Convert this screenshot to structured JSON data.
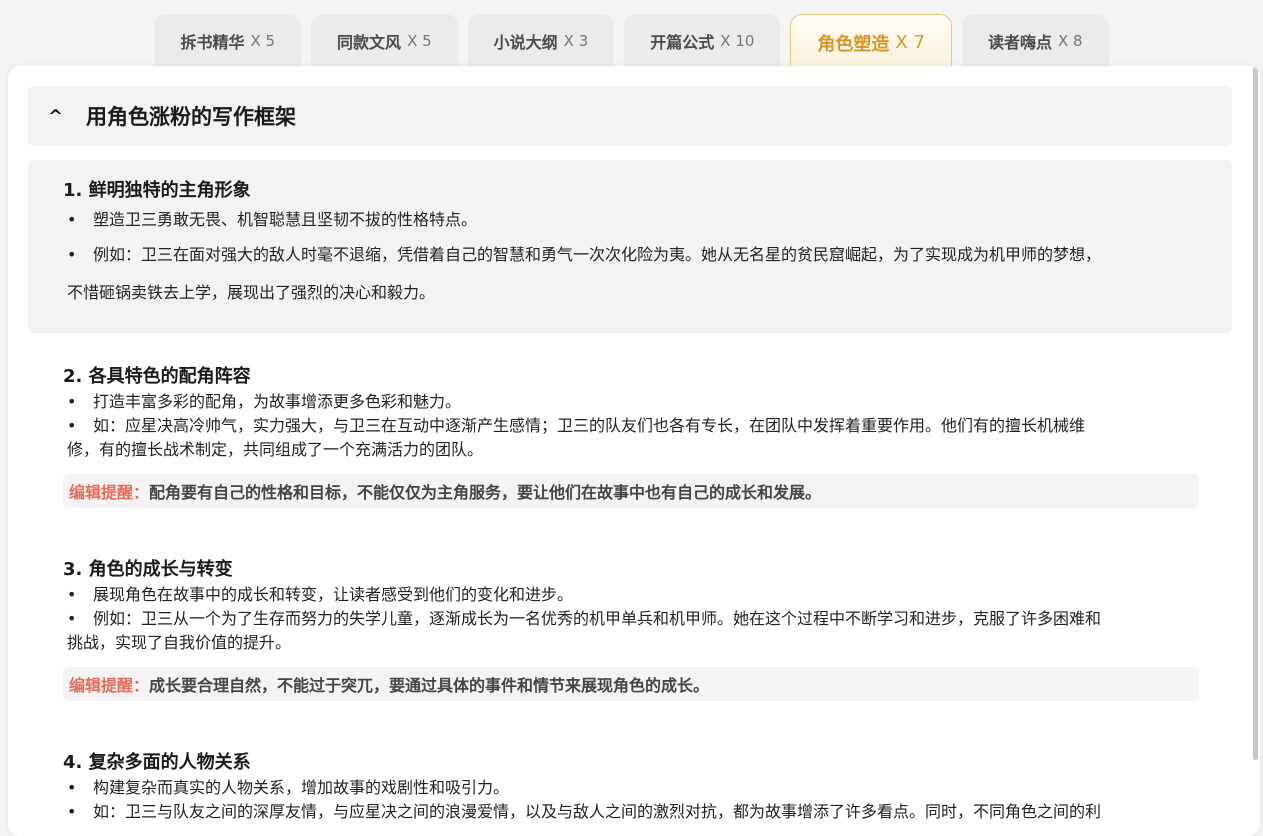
{
  "tabs": [
    {
      "name": "拆书精华",
      "count": "X 5"
    },
    {
      "name": "同款文风",
      "count": "X 5"
    },
    {
      "name": "小说大纲",
      "count": "X 3"
    },
    {
      "name": "开篇公式",
      "count": "X 10"
    },
    {
      "name": "角色塑造",
      "count": "X 7"
    },
    {
      "name": "读者嗨点",
      "count": "X 8"
    }
  ],
  "colors": {
    "accent": "#d8962a",
    "tip_label": "#e56d5c"
  },
  "header": {
    "caret": "^",
    "title": "用角色涨粉的写作框架"
  },
  "sections": [
    {
      "title": "1. 鲜明独特的主角形象",
      "bullets": [
        "塑造卫三勇敢无畏、机智聪慧且坚韧不拔的性格特点。",
        "例如：卫三在面对强大的敌人时毫不退缩，凭借着自己的智慧和勇气一次次化险为夷。她从无名星的贫民窟崛起，为了实现成为机甲师的梦想，"
      ],
      "continuation": "不惜砸锅卖铁去上学，展现出了强烈的决心和毅力。"
    },
    {
      "title": "2. 各具特色的配角阵容",
      "bullets": [
        "打造丰富多彩的配角，为故事增添更多色彩和魅力。",
        "如：应星决高冷帅气，实力强大，与卫三在互动中逐渐产生感情；卫三的队友们也各有专长，在团队中发挥着重要作用。他们有的擅长机械维"
      ],
      "continuation": "修，有的擅长战术制定，共同组成了一个充满活力的团队。",
      "tip_label": "编辑提醒：",
      "tip": "配角要有自己的性格和目标，不能仅仅为主角服务，要让他们在故事中也有自己的成长和发展。"
    },
    {
      "title": "3. 角色的成长与转变",
      "bullets": [
        "展现角色在故事中的成长和转变，让读者感受到他们的变化和进步。",
        "例如：卫三从一个为了生存而努力的失学儿童，逐渐成长为一名优秀的机甲单兵和机甲师。她在这个过程中不断学习和进步，克服了许多困难和"
      ],
      "continuation": "挑战，实现了自我价值的提升。",
      "tip_label": "编辑提醒：",
      "tip": "成长要合理自然，不能过于突兀，要通过具体的事件和情节来展现角色的成长。"
    },
    {
      "title": "4. 复杂多面的人物关系",
      "bullets": [
        "构建复杂而真实的人物关系，增加故事的戏剧性和吸引力。",
        "如：卫三与队友之间的深厚友情，与应星决之间的浪漫爱情，以及与敌人之间的激烈对抗，都为故事增添了许多看点。同时，不同角色之间的利"
      ]
    }
  ]
}
